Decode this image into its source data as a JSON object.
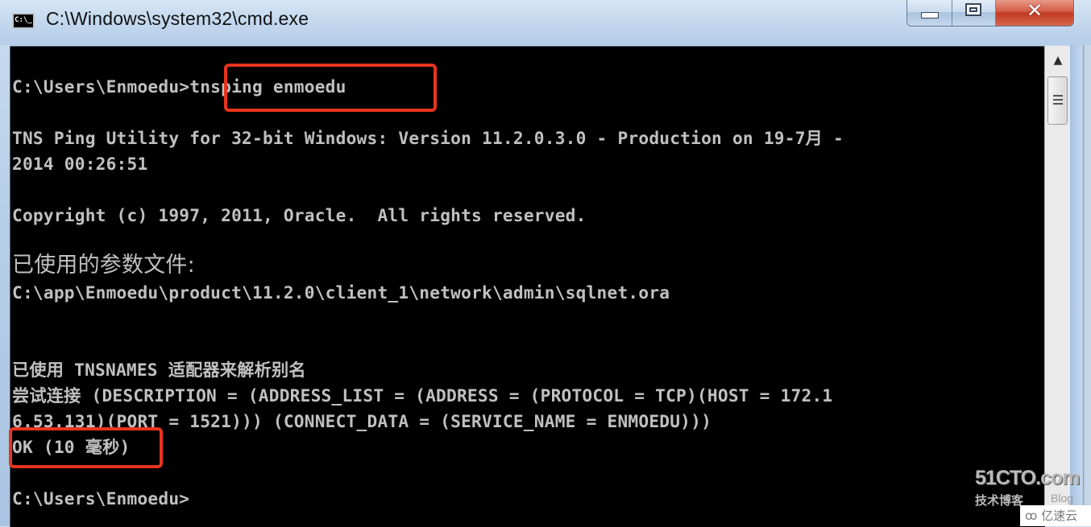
{
  "window": {
    "title": "C:\\Windows\\system32\\cmd.exe",
    "icon_text": "C:\\_",
    "icon": "cmd-icon",
    "buttons": {
      "minimize": "minimize-icon",
      "maximize": "maximize-icon",
      "close": "close-icon",
      "close_glyph": "✕"
    }
  },
  "console": {
    "lines": [
      {
        "text": "C:\\Users\\Enmoedu>tnsping enmoedu"
      },
      {
        "text": "TNS Ping Utility for 32-bit Windows: Version 11.2.0.3.0 - Production on 19-7月 -"
      },
      {
        "text": "2014 00:26:51"
      },
      {
        "text": "Copyright (c) 1997, 2011, Oracle.  All rights reserved."
      },
      {
        "text": "已使用的参数文件:"
      },
      {
        "text": "C:\\app\\Enmoedu\\product\\11.2.0\\client_1\\network\\admin\\sqlnet.ora"
      },
      {
        "text": "已使用 TNSNAMES 适配器来解析别名"
      },
      {
        "text": "尝试连接 (DESCRIPTION = (ADDRESS_LIST = (ADDRESS = (PROTOCOL = TCP)(HOST = 172.1"
      },
      {
        "text": "6.53.131)(PORT = 1521))) (CONNECT_DATA = (SERVICE_NAME = ENMOEDU)))"
      },
      {
        "text": "OK (10 毫秒)"
      },
      {
        "text": "C:\\Users\\Enmoedu>"
      }
    ],
    "highlight_color": "#e8341c",
    "text_color": "#c0c0c0",
    "background": "#000000"
  },
  "scrollbar": {
    "up_arrow": "▲"
  },
  "watermark": {
    "logo": "51CTO.com",
    "subtitle": "技术博客",
    "blog": "Blog",
    "brand": "亿速云",
    "brand_icon": "ꝏ"
  }
}
